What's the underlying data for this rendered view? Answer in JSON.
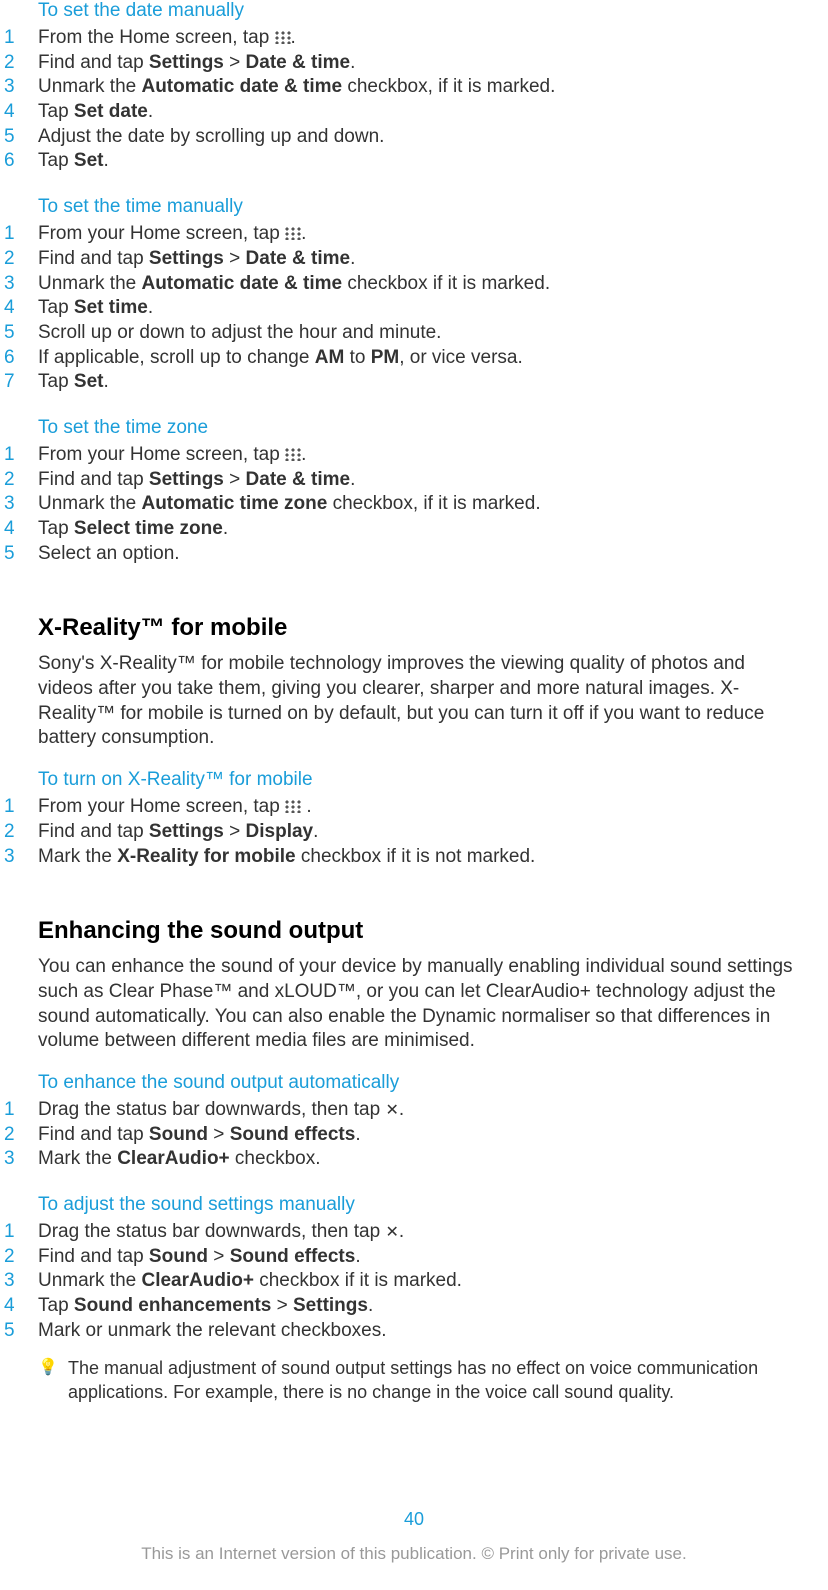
{
  "sec1": {
    "title": "To set the date manually",
    "s1a": "From the Home screen, tap ",
    "s1b": ".",
    "s2a": "Find and tap ",
    "s2b": "Settings",
    "s2c": " > ",
    "s2d": "Date & time",
    "s2e": ".",
    "s3a": "Unmark the ",
    "s3b": "Automatic date & time",
    "s3c": " checkbox, if it is marked.",
    "s4a": "Tap ",
    "s4b": "Set date",
    "s4c": ".",
    "s5": "Adjust the date by scrolling up and down.",
    "s6a": "Tap ",
    "s6b": "Set",
    "s6c": "."
  },
  "sec2": {
    "title": "To set the time manually",
    "s1a": "From your Home screen, tap ",
    "s1b": ".",
    "s2a": "Find and tap ",
    "s2b": "Settings",
    "s2c": " > ",
    "s2d": "Date & time",
    "s2e": ".",
    "s3a": "Unmark the ",
    "s3b": "Automatic date & time",
    "s3c": " checkbox if it is marked.",
    "s4a": "Tap ",
    "s4b": "Set time",
    "s4c": ".",
    "s5": "Scroll up or down to adjust the hour and minute.",
    "s6a": "If applicable, scroll up to change ",
    "s6b": "AM",
    "s6c": " to ",
    "s6d": "PM",
    "s6e": ", or vice versa.",
    "s7a": "Tap ",
    "s7b": "Set",
    "s7c": "."
  },
  "sec3": {
    "title": "To set the time zone",
    "s1a": "From your Home screen, tap ",
    "s1b": ".",
    "s2a": "Find and tap ",
    "s2b": "Settings",
    "s2c": " > ",
    "s2d": "Date & time",
    "s2e": ".",
    "s3a": "Unmark the ",
    "s3b": "Automatic time zone",
    "s3c": " checkbox, if it is marked.",
    "s4a": "Tap ",
    "s4b": "Select time zone",
    "s4c": ".",
    "s5": "Select an option."
  },
  "xreality": {
    "heading": "X-Reality™ for mobile",
    "para": "Sony's X-Reality™ for mobile technology improves the viewing quality of photos and videos after you take them, giving you clearer, sharper and more natural images. X-Reality™ for mobile is turned on by default, but you can turn it off if you want to reduce battery consumption.",
    "subhead": "To turn on X-Reality™ for mobile",
    "s1a": "From your Home screen, tap ",
    "s1b": " .",
    "s2a": "Find and tap ",
    "s2b": "Settings",
    "s2c": " > ",
    "s2d": "Display",
    "s2e": ".",
    "s3a": "Mark the ",
    "s3b": "X-Reality for mobile",
    "s3c": " checkbox if it is not marked."
  },
  "sound": {
    "heading": "Enhancing the sound output",
    "para": "You can enhance the sound of your device by manually enabling individual sound settings such as Clear Phase™ and xLOUD™, or you can let ClearAudio+ technology adjust the sound automatically. You can also enable the Dynamic normaliser so that differences in volume between different media files are minimised.",
    "sub1": "To enhance the sound output automatically",
    "a1a": "Drag the status bar downwards, then tap ",
    "a1b": ".",
    "a2a": "Find and tap ",
    "a2b": "Sound",
    "a2c": " > ",
    "a2d": "Sound effects",
    "a2e": ".",
    "a3a": "Mark the ",
    "a3b": "ClearAudio+",
    "a3c": " checkbox.",
    "sub2": "To adjust the sound settings manually",
    "b1a": "Drag the status bar downwards, then tap ",
    "b1b": ".",
    "b2a": "Find and tap ",
    "b2b": "Sound",
    "b2c": " > ",
    "b2d": "Sound effects",
    "b2e": ".",
    "b3a": "Unmark the ",
    "b3b": "ClearAudio+",
    "b3c": " checkbox if it is marked.",
    "b4a": "Tap ",
    "b4b": "Sound enhancements",
    "b4c": " > ",
    "b4d": "Settings",
    "b4e": ".",
    "b5": "Mark or unmark the relevant checkboxes.",
    "tip": "The manual adjustment of sound output settings has no effect on voice communication applications. For example, there is no change in the voice call sound quality."
  },
  "pagenum": "40",
  "footer": "This is an Internet version of this publication. © Print only for private use.",
  "nums": {
    "n1": "1",
    "n2": "2",
    "n3": "3",
    "n4": "4",
    "n5": "5",
    "n6": "6",
    "n7": "7"
  }
}
